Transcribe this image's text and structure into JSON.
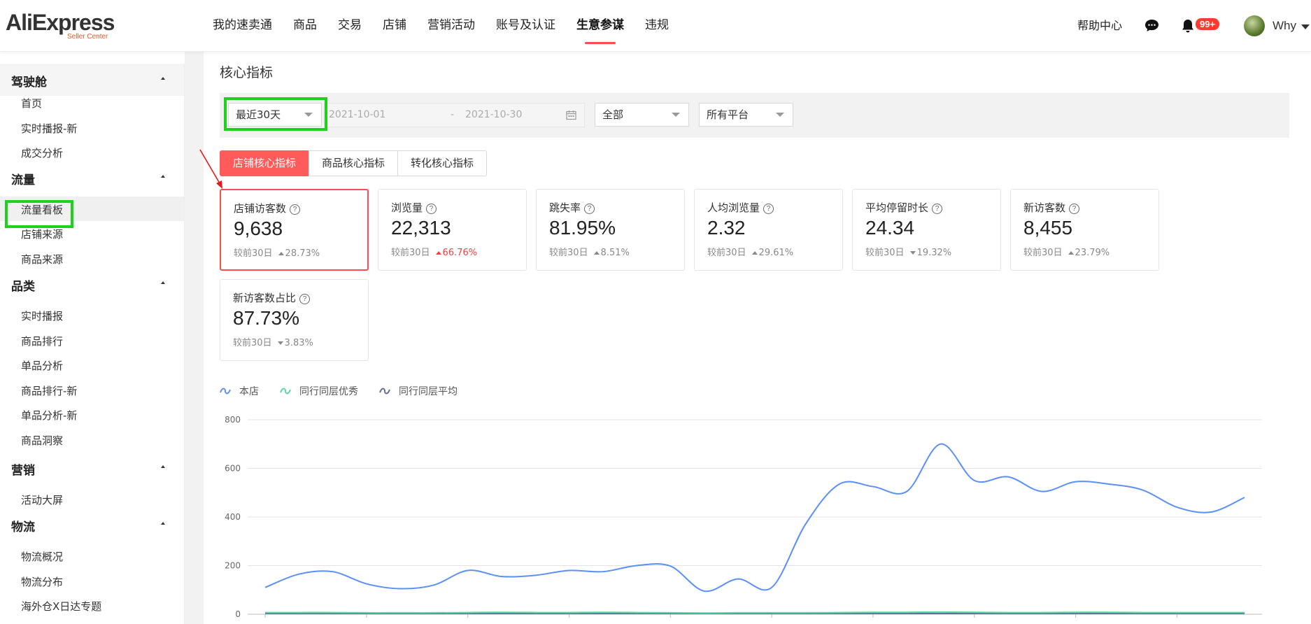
{
  "header": {
    "logo_text": "AliExpress",
    "logo_sub": "Seller Center",
    "nav": [
      {
        "label": "我的速卖通"
      },
      {
        "label": "商品"
      },
      {
        "label": "交易"
      },
      {
        "label": "店铺"
      },
      {
        "label": "营销活动"
      },
      {
        "label": "账号及认证"
      },
      {
        "label": "生意参谋",
        "active": true
      },
      {
        "label": "违规"
      }
    ],
    "help_label": "帮助中心",
    "chat_icon": "chat-bubble-icon",
    "bell_icon": "bell-icon",
    "notification_badge": "99+",
    "username": "Why"
  },
  "sidebar": {
    "groups": [
      {
        "title": "驾驶舱",
        "items": [
          "首页",
          "实时播报-新",
          "成交分析"
        ]
      },
      {
        "title": "流量",
        "items": [
          "流量看板",
          "店铺来源",
          "商品来源"
        ]
      },
      {
        "title": "品类",
        "items": [
          "实时播报",
          "商品排行",
          "单品分析",
          "商品排行-新",
          "单品分析-新",
          "商品洞察"
        ]
      },
      {
        "title": "营销",
        "items": [
          "活动大屏"
        ]
      },
      {
        "title": "物流",
        "items": [
          "物流概况",
          "物流分布",
          "海外仓X日达专题"
        ]
      }
    ],
    "active_item": "流量看板"
  },
  "main": {
    "section_title": "核心指标",
    "filters": {
      "period": "最近30天",
      "date_start": "2021-10-01",
      "date_sep": "-",
      "date_end": "2021-10-30",
      "scope": "全部",
      "platform": "所有平台"
    },
    "tabs": [
      {
        "label": "店铺核心指标",
        "active": true
      },
      {
        "label": "商品核心指标"
      },
      {
        "label": "转化核心指标"
      }
    ],
    "metrics": [
      {
        "title": "店铺访客数",
        "value": "9,638",
        "compare_label": "较前30日",
        "delta": "28.73%",
        "direction": "up",
        "color": "gray",
        "selected": true
      },
      {
        "title": "浏览量",
        "value": "22,313",
        "compare_label": "较前30日",
        "delta": "66.76%",
        "direction": "up",
        "color": "red"
      },
      {
        "title": "跳失率",
        "value": "81.95%",
        "compare_label": "较前30日",
        "delta": "8.51%",
        "direction": "up",
        "color": "gray"
      },
      {
        "title": "人均浏览量",
        "value": "2.32",
        "compare_label": "较前30日",
        "delta": "29.61%",
        "direction": "up",
        "color": "gray"
      },
      {
        "title": "平均停留时长",
        "value": "24.34",
        "compare_label": "较前30日",
        "delta": "19.32%",
        "direction": "down",
        "color": "gray"
      },
      {
        "title": "新访客数",
        "value": "8,455",
        "compare_label": "较前30日",
        "delta": "23.79%",
        "direction": "up",
        "color": "gray"
      },
      {
        "title": "新访客数占比",
        "value": "87.73%",
        "compare_label": "较前30日",
        "delta": "3.83%",
        "direction": "down",
        "color": "gray"
      }
    ],
    "legend": [
      {
        "name": "本店",
        "color": "#5b8ff9"
      },
      {
        "name": "同行同层优秀",
        "color": "#5ad8a6"
      },
      {
        "name": "同行同层平均",
        "color": "#5d7092"
      }
    ]
  },
  "chart_data": {
    "type": "line",
    "ylim": [
      0,
      800
    ],
    "yticks": [
      0,
      200,
      400,
      600,
      800
    ],
    "grid": true,
    "series": [
      {
        "name": "本店",
        "color": "#5b8ff9",
        "values": [
          110,
          165,
          175,
          125,
          105,
          120,
          180,
          155,
          160,
          180,
          175,
          200,
          198,
          95,
          145,
          110,
          370,
          535,
          525,
          505,
          700,
          550,
          565,
          505,
          545,
          535,
          510,
          440,
          420,
          480
        ]
      },
      {
        "name": "同行同层优秀",
        "color": "#5ad8a6",
        "values": [
          7,
          7,
          7,
          6,
          6,
          6,
          7,
          8,
          7,
          7,
          8,
          7,
          6,
          5,
          6,
          6,
          6,
          7,
          8,
          8,
          9,
          8,
          7,
          7,
          8,
          8,
          7,
          7,
          7,
          7
        ]
      },
      {
        "name": "同行同层平均",
        "color": "#5d7092",
        "values": [
          3,
          3,
          3,
          3,
          3,
          3,
          3,
          3,
          3,
          3,
          3,
          3,
          3,
          3,
          3,
          3,
          3,
          3,
          3,
          3,
          3,
          3,
          3,
          3,
          3,
          3,
          3,
          3,
          3,
          3
        ]
      }
    ]
  }
}
